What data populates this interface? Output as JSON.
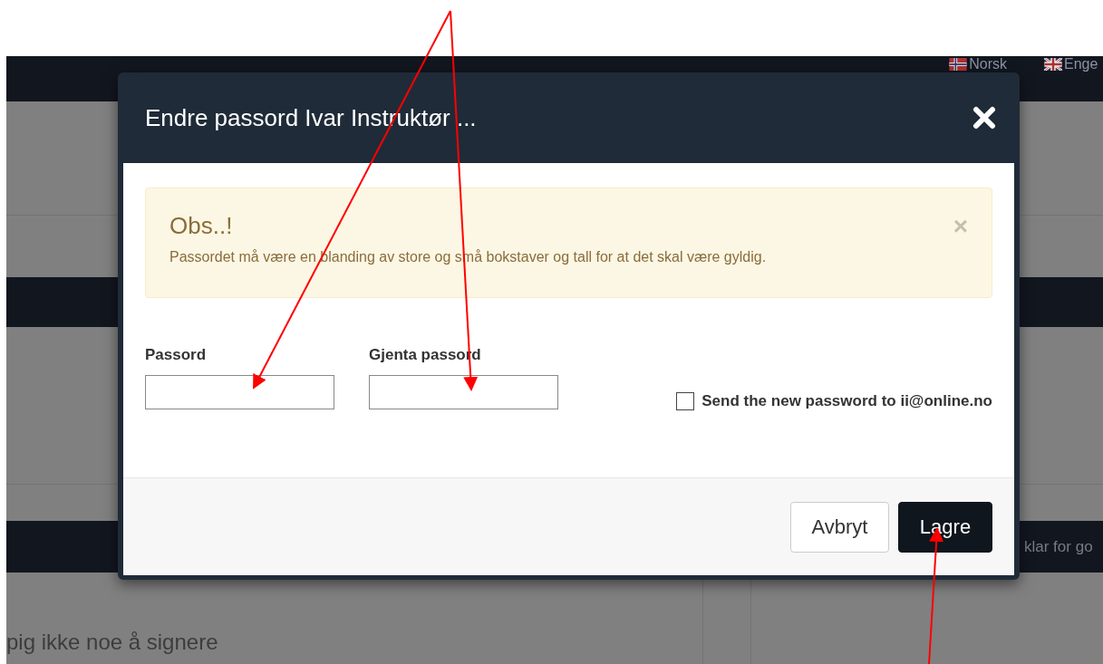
{
  "top_bar": {
    "languages": [
      {
        "label": "Norsk",
        "kind": "norway"
      },
      {
        "label": "Enge",
        "kind": "uk"
      }
    ]
  },
  "background": {
    "banner_text": "klar for go",
    "content_text": "pig ikke noe å signere"
  },
  "dialog": {
    "title": "Endre passord Ivar Instruktør ...",
    "alert": {
      "title": "Obs..!",
      "message": "Passordet må være en blanding av store og små bokstaver og tall for at det skal være gyldig.",
      "close": "×"
    },
    "fields": [
      {
        "label": "Passord"
      },
      {
        "label": "Gjenta passord"
      }
    ],
    "checkbox": {
      "label": "Send the new password to ii@online.no",
      "checked": false
    },
    "buttons": [
      {
        "label": "Avbryt",
        "kind": "default"
      },
      {
        "label": "Lagre",
        "kind": "primary"
      }
    ]
  }
}
